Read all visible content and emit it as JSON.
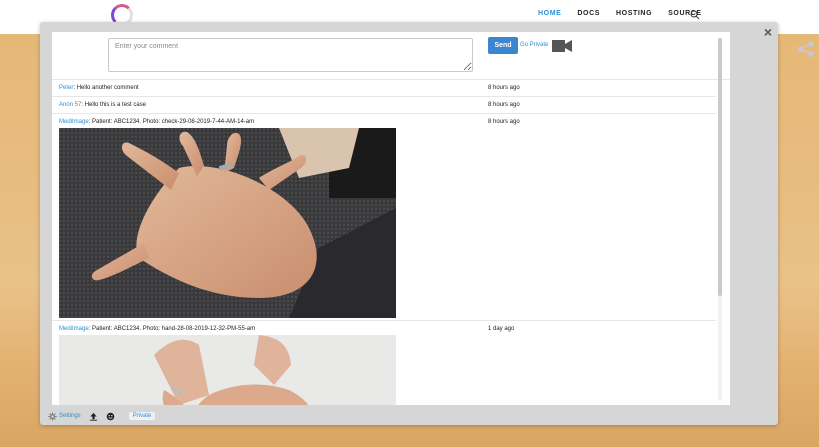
{
  "nav": {
    "items": [
      "HOME",
      "DOCS",
      "HOSTING",
      "SOURCE"
    ],
    "active": "HOME",
    "search_icon": "search-icon"
  },
  "modal": {
    "close_label": "×",
    "compose": {
      "placeholder": "Enter your comment",
      "value": "",
      "send_label": "Send",
      "go_private_label": "Go Private",
      "video_icon": "video-camera-icon"
    },
    "comments": [
      {
        "author": "Peter",
        "text": "Hello another comment",
        "time": "8 hours ago"
      },
      {
        "author": "Anon 57",
        "text": "Hello this is a test case",
        "time": "8 hours ago"
      },
      {
        "author": "MediImage",
        "text": "Patient: ABC1234. Photo: check-29-08-2019-7-44-AM-14-am",
        "time": "8 hours ago",
        "has_image": true
      },
      {
        "author": "MediImage",
        "text": "Patient: ABC1234. Photo: hand-28-08-2019-12-32-PM-55-am",
        "time": "1 day ago",
        "has_image": true
      }
    ],
    "footer": {
      "settings_label": "Settings",
      "upload_icon": "upload-icon",
      "emoji_icon": "emoji-icon",
      "private_label": "Private"
    }
  },
  "colors": {
    "accent": "#2d8fd5",
    "send_button": "#3a87d0",
    "overlay": "#d6d6d6"
  }
}
